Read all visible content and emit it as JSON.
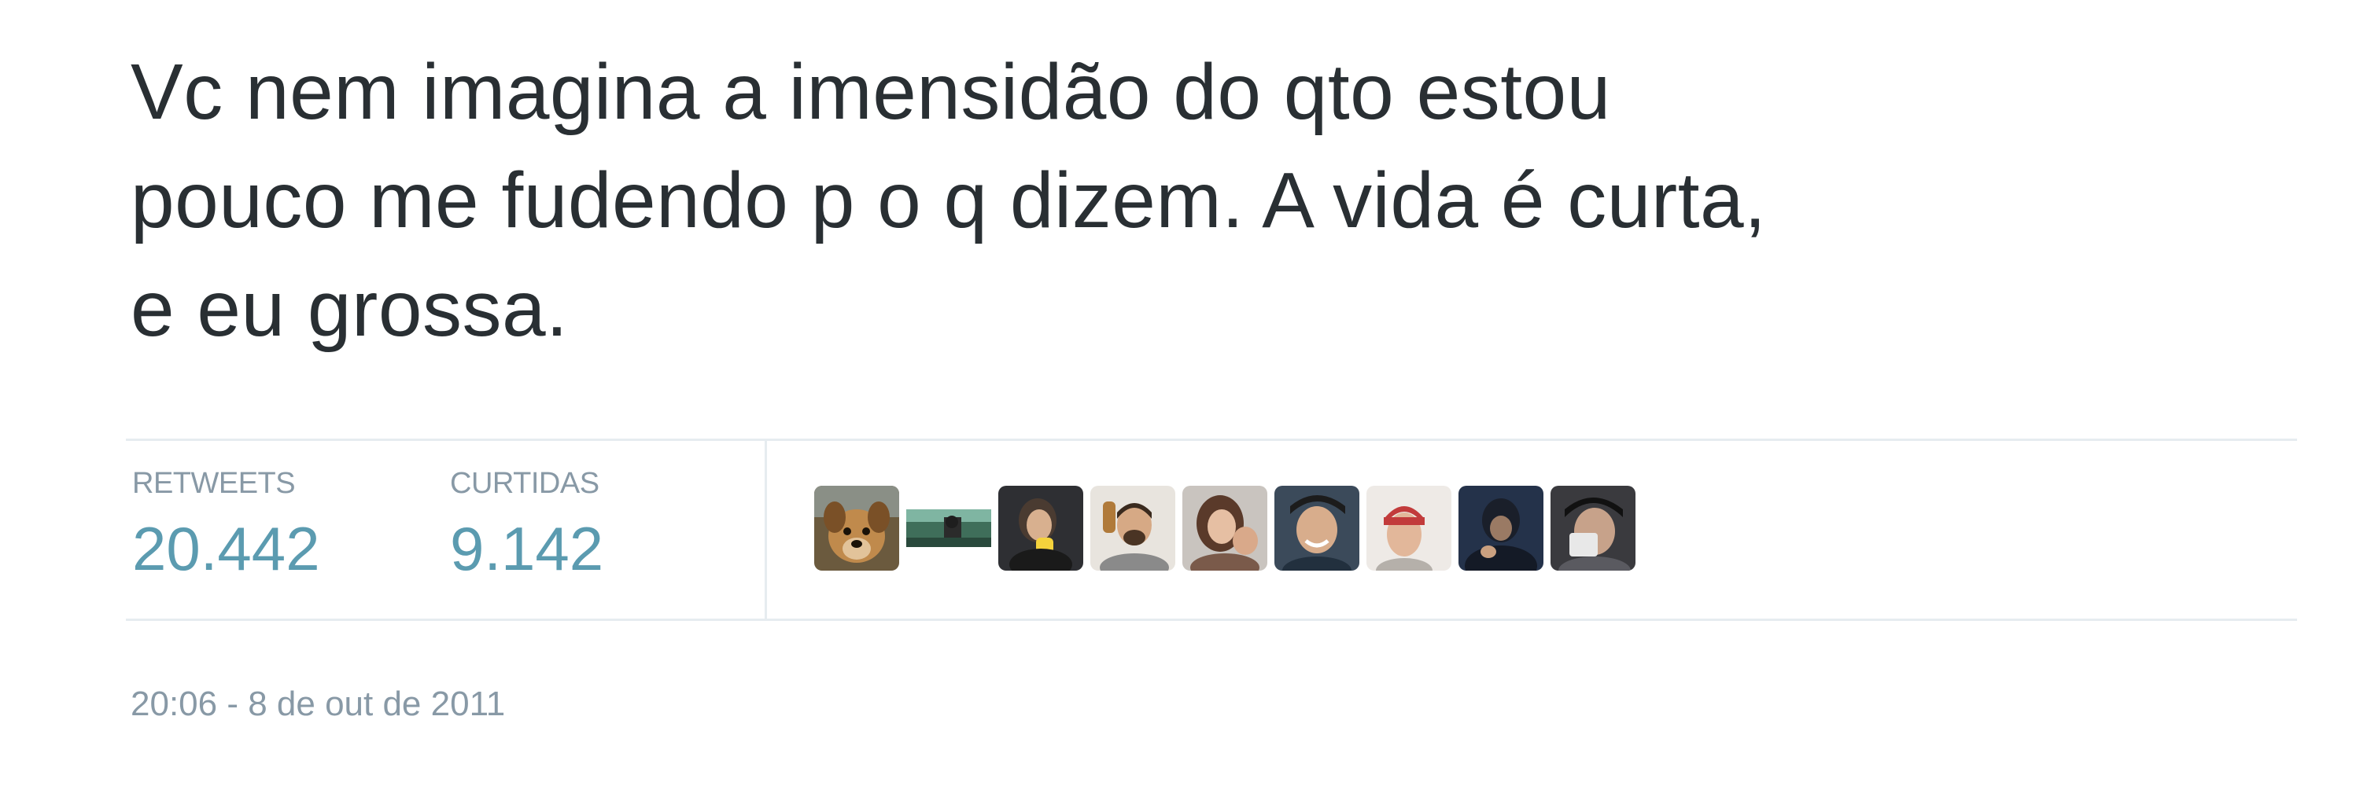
{
  "tweet": {
    "text_lines": [
      "Vc nem imagina a imensidão do qto estou",
      "pouco me fudendo p o q dizem. A vida é curta,",
      "e eu grossa."
    ],
    "retweets_label": "RETWEETS",
    "retweets_count": "20.442",
    "likes_label": "CURTIDAS",
    "likes_count": "9.142",
    "timestamp": "20:06 - 8 de out de 2011"
  },
  "colors": {
    "text": "#292f33",
    "muted": "#8899a6",
    "count": "#5b9bb0",
    "border": "#e6ecf0"
  },
  "avatars": [
    "avatar-dog",
    "avatar-landscape",
    "avatar-person",
    "avatar-person",
    "avatar-person",
    "avatar-person",
    "avatar-person",
    "avatar-person",
    "avatar-person"
  ]
}
